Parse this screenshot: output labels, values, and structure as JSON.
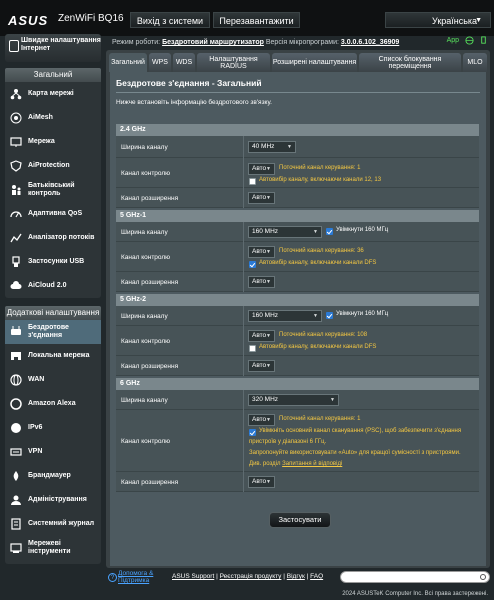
{
  "app": {
    "brand": "ASUS",
    "model": "ZenWiFi BQ16"
  },
  "top": {
    "logout": "Вихід з системи",
    "reboot": "Перезавантажити",
    "language": "Українська"
  },
  "status": {
    "mode_label": "Режим роботи:",
    "mode_value": "Бездротовий маршрутизатор",
    "fw_label": "Версія мікропрограми:",
    "fw_value": "3.0.0.6.102_36909",
    "app": "App"
  },
  "sidebar": {
    "qis": "Швидке налаштування Інтернет",
    "general_header": "Загальний",
    "general": [
      {
        "label": "Карта мережі",
        "icon": "network-map-icon"
      },
      {
        "label": "AiMesh",
        "icon": "aimesh-icon"
      },
      {
        "label": "Мережа",
        "icon": "network-icon"
      },
      {
        "label": "AiProtection",
        "icon": "shield-icon"
      },
      {
        "label": "Батьківський контроль",
        "icon": "parental-icon"
      },
      {
        "label": "Адаптивна QoS",
        "icon": "qos-icon"
      },
      {
        "label": "Аналізатор потоків",
        "icon": "traffic-icon"
      },
      {
        "label": "Застосунки USB",
        "icon": "usb-icon"
      },
      {
        "label": "AiCloud 2.0",
        "icon": "cloud-icon"
      }
    ],
    "advanced_header": "Додаткові налаштування",
    "advanced": [
      {
        "label": "Бездротове з'єднання",
        "icon": "wireless-icon"
      },
      {
        "label": "Локальна мережа",
        "icon": "lan-icon"
      },
      {
        "label": "WAN",
        "icon": "wan-icon"
      },
      {
        "label": "Amazon Alexa",
        "icon": "alexa-icon"
      },
      {
        "label": "IPv6",
        "icon": "ipv6-icon"
      },
      {
        "label": "VPN",
        "icon": "vpn-icon"
      },
      {
        "label": "Брандмауер",
        "icon": "firewall-icon"
      },
      {
        "label": "Адміністрування",
        "icon": "admin-icon"
      },
      {
        "label": "Системний журнал",
        "icon": "log-icon"
      },
      {
        "label": "Мережеві інструменти",
        "icon": "tools-icon"
      }
    ]
  },
  "tabs": [
    "Загальний",
    "WPS",
    "WDS",
    "Налаштування RADIUS",
    "Розширені налаштування",
    "Список блокування переміщення",
    "MLO"
  ],
  "panel": {
    "title": "Бездротове з'єднання - Загальний",
    "desc": "Нижче встановіть інформацію бездротового зв'язку."
  },
  "bands": {
    "b24": {
      "name": "2.4 GHz",
      "width_label": "Ширина каналу",
      "width_value": "40 MHz",
      "ctrl_label": "Канал контролю",
      "ctrl_value": "Авто",
      "ctrl_current": "Поточний канал керування: 1",
      "ctrl_auto": "Автовибір каналу, включаючи канали 12, 13",
      "ext_label": "Канал розширення",
      "ext_value": "Авто"
    },
    "b51": {
      "name": "5 GHz-1",
      "width_label": "Ширина каналу",
      "width_value": "160 MHz",
      "width_check": "Увімкнути 160 МГц",
      "ctrl_label": "Канал контролю",
      "ctrl_value": "Авто",
      "ctrl_current": "Поточний канал керування: 36",
      "ctrl_auto": "Автовибір каналу, включаючи канали DFS",
      "ext_label": "Канал розширення",
      "ext_value": "Авто"
    },
    "b52": {
      "name": "5 GHz-2",
      "width_label": "Ширина каналу",
      "width_value": "160 MHz",
      "width_check": "Увімкнути 160 МГц",
      "ctrl_label": "Канал контролю",
      "ctrl_value": "Авто",
      "ctrl_current": "Поточний канал керування: 108",
      "ctrl_auto": "Автовибір каналу, включаючи канали DFS",
      "ext_label": "Канал розширення",
      "ext_value": "Авто"
    },
    "b6": {
      "name": "6 GHz",
      "width_label": "Ширина каналу",
      "width_value": "320 MHz",
      "ctrl_label": "Канал контролю",
      "ctrl_value": "Авто",
      "ctrl_current": "Поточний канал керування: 1",
      "psc_line1": "Увімкніть основний канал сканування (PSC), щоб забезпечити з'єднання",
      "psc_line2": "пристроїв у діапазоні 6 ГГц.",
      "suggest": "Запропонуйте використовувати «Auto» для кращої сумісності з пристроями.",
      "faq_prefix": "Див. розділ",
      "faq_link": "Запитання й відповіді",
      "ext_label": "Канал розширення",
      "ext_value": "Авто"
    }
  },
  "apply": "Застосувати",
  "footer": {
    "help": "Допомога & Підтримка",
    "support": "ASUS Support",
    "register": "Реєстрація продукту",
    "feedback": "Відгук",
    "faq": "FAQ",
    "sep": "|",
    "copyright": "2024 ASUSTeK Computer Inc. Всі права застережені."
  },
  "colors": {
    "accent_yellow": "#f5c842",
    "checkbox_blue": "#2a7ad6",
    "active_nav": "#4f6b7a"
  }
}
